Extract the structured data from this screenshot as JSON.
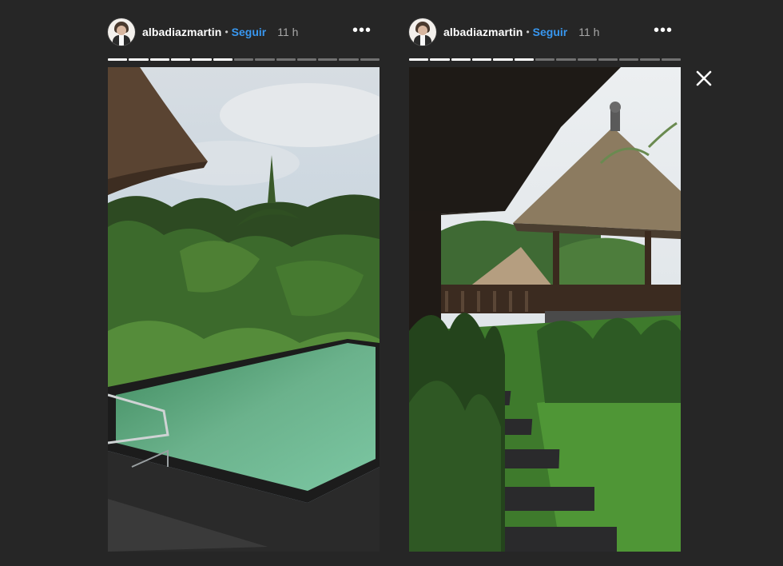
{
  "stories": [
    {
      "username": "albadiazmartin",
      "separator": "•",
      "follow_label": "Seguir",
      "time": "11 h",
      "more_label": "•••",
      "progress_total": 13,
      "progress_done": 6,
      "image": "pool-jungle"
    },
    {
      "username": "albadiazmartin",
      "separator": "•",
      "follow_label": "Seguir",
      "time": "11 h",
      "more_label": "•••",
      "progress_total": 13,
      "progress_done": 6,
      "image": "garden-pavilion"
    }
  ],
  "icons": {
    "close": "close-icon",
    "more": "more-options-icon",
    "avatar": "avatar"
  },
  "colors": {
    "background": "#262626",
    "follow": "#3897f0",
    "text": "#ffffff",
    "muted": "#a8a8a8"
  }
}
